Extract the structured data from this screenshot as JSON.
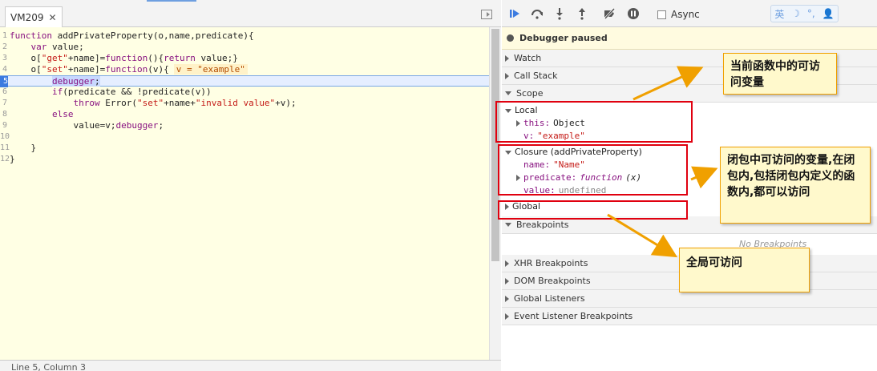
{
  "source": {
    "tab_label": "VM209",
    "status": "Line 5, Column 3",
    "inline_value": "v = \"example\"",
    "line_numbers": [
      "1",
      "2",
      "3",
      "4",
      "5",
      "6",
      "7",
      "8",
      "9",
      "10",
      "11",
      "12"
    ]
  },
  "debugger": {
    "async_label": "Async",
    "paused_text": "Debugger paused",
    "sections": {
      "watch": "Watch",
      "call_stack": "Call Stack",
      "scope": "Scope",
      "breakpoints": "Breakpoints",
      "xhr": "XHR Breakpoints",
      "dom": "DOM Breakpoints",
      "global_listeners": "Global Listeners",
      "event_listener": "Event Listener Breakpoints"
    },
    "no_breakpoints": "No Breakpoints",
    "scope": {
      "local_label": "Local",
      "local_this_key": "this:",
      "local_this_val": "Object",
      "local_v_key": "v:",
      "local_v_val": "\"example\"",
      "closure_label": "Closure (addPrivateProperty)",
      "name_key": "name:",
      "name_val": "\"Name\"",
      "predicate_key": "predicate:",
      "predicate_val_kw": "function",
      "predicate_val_rest": "(x)",
      "value_key": "value:",
      "value_val": "undefined",
      "global_label": "Global"
    },
    "ime_glyphs": [
      "英",
      "☽",
      "°,",
      "👤"
    ]
  },
  "annotations": {
    "note1": "当前函数中的可访问变量",
    "note2": "闭包中可访问的变量,在闭包内,包括闭包内定义的函数内,都可以访问",
    "note3": "全局可访问"
  },
  "colors": {
    "highlight_box": "#e0000f",
    "note_border": "#f0a000",
    "arrow": "#f0a000",
    "editor_bg": "#ffffe4"
  }
}
